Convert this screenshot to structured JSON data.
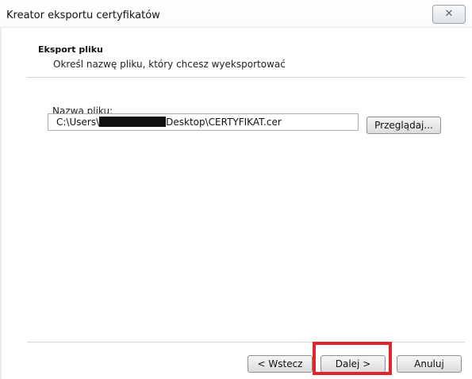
{
  "window": {
    "title": "Kreator eksportu certyfikatów",
    "close_icon": "close-icon"
  },
  "section": {
    "title": "Eksport pliku",
    "description": "Określ nazwę pliku, który chcesz wyeksportować"
  },
  "file": {
    "label": "Nazwa pliku:",
    "value_prefix": "C:\\Users\\",
    "value_suffix": "Desktop\\CERTYFIKAT.cer"
  },
  "buttons": {
    "browse": "Przeglądaj...",
    "back": "< Wstecz",
    "next": "Dalej >",
    "cancel": "Anuluj"
  },
  "colors": {
    "highlight": "#e0262d"
  }
}
